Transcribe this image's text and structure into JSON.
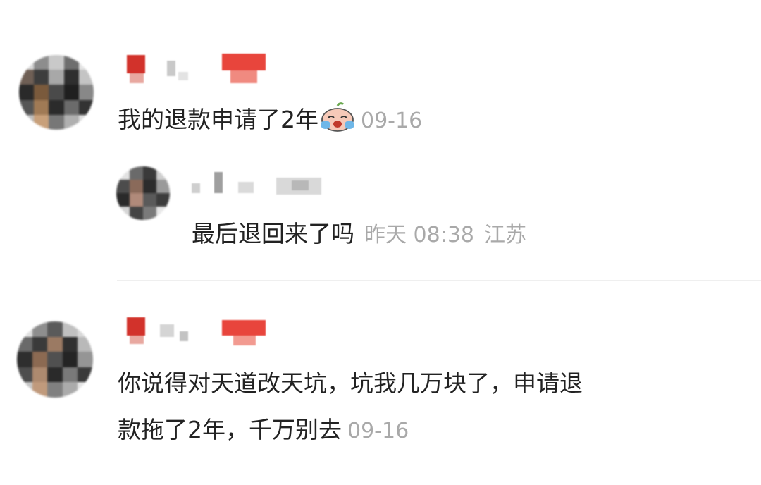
{
  "comments": [
    {
      "text": "我的退款申请了2年",
      "emoji": "crying-face",
      "date": "09-16",
      "reply": {
        "text": "最后退回来了吗",
        "date": "昨天 08:38",
        "location": "江苏"
      }
    },
    {
      "line1": "你说得对天道改天坑，坑我几万块了，申请退",
      "line2": "款拖了2年，千万别去",
      "date": "09-16"
    }
  ],
  "colors": {
    "text": "#222222",
    "meta": "#a9a9a9",
    "divider": "#efefef",
    "redacted_red": "#e8453c"
  }
}
